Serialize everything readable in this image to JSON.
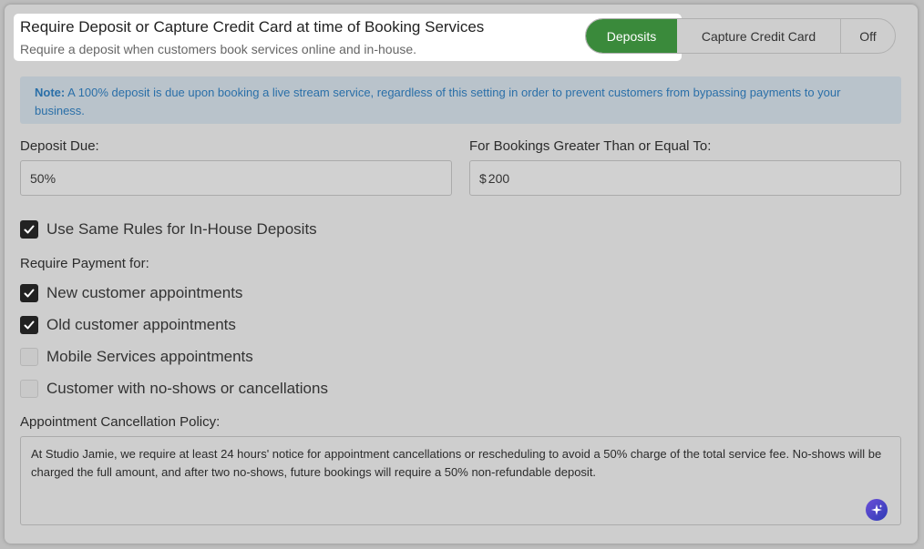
{
  "header": {
    "title": "Require Deposit or Capture Credit Card at time of Booking Services",
    "subtitle": "Require a deposit when customers book services online and in-house."
  },
  "mode_toggle": {
    "options": [
      "Deposits",
      "Capture Credit Card",
      "Off"
    ],
    "selected": "Deposits"
  },
  "note": {
    "label": "Note:",
    "text": "A 100% deposit is due upon booking a live stream service, regardless of this setting in order to prevent customers from bypassing payments to your business."
  },
  "deposit_due": {
    "label": "Deposit Due:",
    "value": "50%"
  },
  "min_booking": {
    "label": "For Bookings Greater Than or Equal To:",
    "currency": "$",
    "value": "200"
  },
  "same_rules": {
    "label": "Use Same Rules for In-House Deposits",
    "checked": true
  },
  "require_payment": {
    "heading": "Require Payment for:",
    "options": [
      {
        "label": "New customer appointments",
        "checked": true
      },
      {
        "label": "Old customer appointments",
        "checked": true
      },
      {
        "label": "Mobile Services appointments",
        "checked": false
      },
      {
        "label": "Customer with no-shows or cancellations",
        "checked": false
      }
    ]
  },
  "cancellation_policy": {
    "label": "Appointment Cancellation Policy:",
    "text": "At Studio Jamie, we require at least 24 hours' notice for appointment cancellations or rescheduling to avoid a 50% charge of the total service fee. No-shows will be charged the full amount, and after two no-shows, future bookings will require a 50% non-refundable deposit."
  },
  "colors": {
    "accent_green": "#3a8a3b",
    "note_text_blue": "#2a6fa8",
    "ai_button": "#4a3fd0"
  },
  "icons": {
    "checkbox_checked": "checkmark-icon",
    "ai_assist": "sparkle-icon"
  }
}
